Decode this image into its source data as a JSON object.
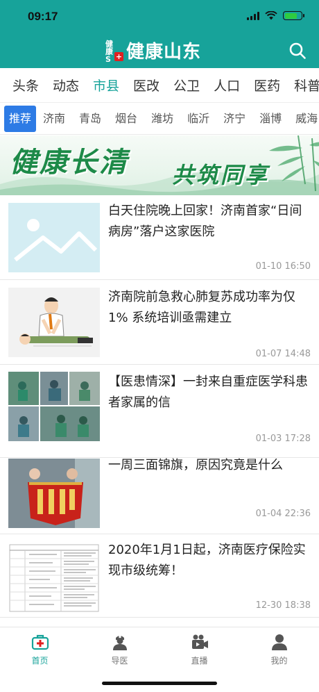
{
  "status": {
    "time": "09:17"
  },
  "header": {
    "logo_badge": "健康S",
    "logo_cross": "+",
    "title": "健康山东",
    "search_icon": "search-icon",
    "bg_color": "#17a39a"
  },
  "category_tabs": [
    {
      "label": "头条",
      "active": false
    },
    {
      "label": "动态",
      "active": false
    },
    {
      "label": "市县",
      "active": true
    },
    {
      "label": "医改",
      "active": false
    },
    {
      "label": "公卫",
      "active": false
    },
    {
      "label": "人口",
      "active": false
    },
    {
      "label": "医药",
      "active": false
    },
    {
      "label": "科普",
      "active": false
    }
  ],
  "city_tabs": [
    {
      "label": "推荐",
      "active": true
    },
    {
      "label": "济南",
      "active": false
    },
    {
      "label": "青岛",
      "active": false
    },
    {
      "label": "烟台",
      "active": false
    },
    {
      "label": "潍坊",
      "active": false
    },
    {
      "label": "临沂",
      "active": false
    },
    {
      "label": "济宁",
      "active": false
    },
    {
      "label": "淄博",
      "active": false
    },
    {
      "label": "威海",
      "active": false
    }
  ],
  "banner": {
    "text_main": "健康长清",
    "text_sub": "共筑同享"
  },
  "news": [
    {
      "title": "白天住院晚上回家！济南首家“日间病房”落户这家医院",
      "time": "01-10 16:50",
      "thumb": "placeholder-image"
    },
    {
      "title": "济南院前急救心肺复苏成功率为仅1% 系统培训亟需建立",
      "time": "01-07 14:48",
      "thumb": "cpr-illustration"
    },
    {
      "title": "【医患情深】一封来自重症医学科患者家属的信",
      "time": "01-03 17:28",
      "thumb": "icu-photos"
    },
    {
      "title": "一周三面锦旗，原因究竟是什么",
      "time": "01-04 22:36",
      "thumb": "banner-photo"
    },
    {
      "title": "2020年1月1日起，济南医疗保险实现市级统筹！",
      "time": "12-30 18:38",
      "thumb": "document-table"
    }
  ],
  "tabbar": [
    {
      "label": "首页",
      "icon": "medical-kit-icon",
      "active": true
    },
    {
      "label": "导医",
      "icon": "doctor-icon",
      "active": false
    },
    {
      "label": "直播",
      "icon": "video-camera-icon",
      "active": false
    },
    {
      "label": "我的",
      "icon": "user-icon",
      "active": false
    }
  ],
  "colors": {
    "accent": "#17a39a",
    "city_active": "#2d7be5",
    "banner_green": "#1d8a48"
  }
}
